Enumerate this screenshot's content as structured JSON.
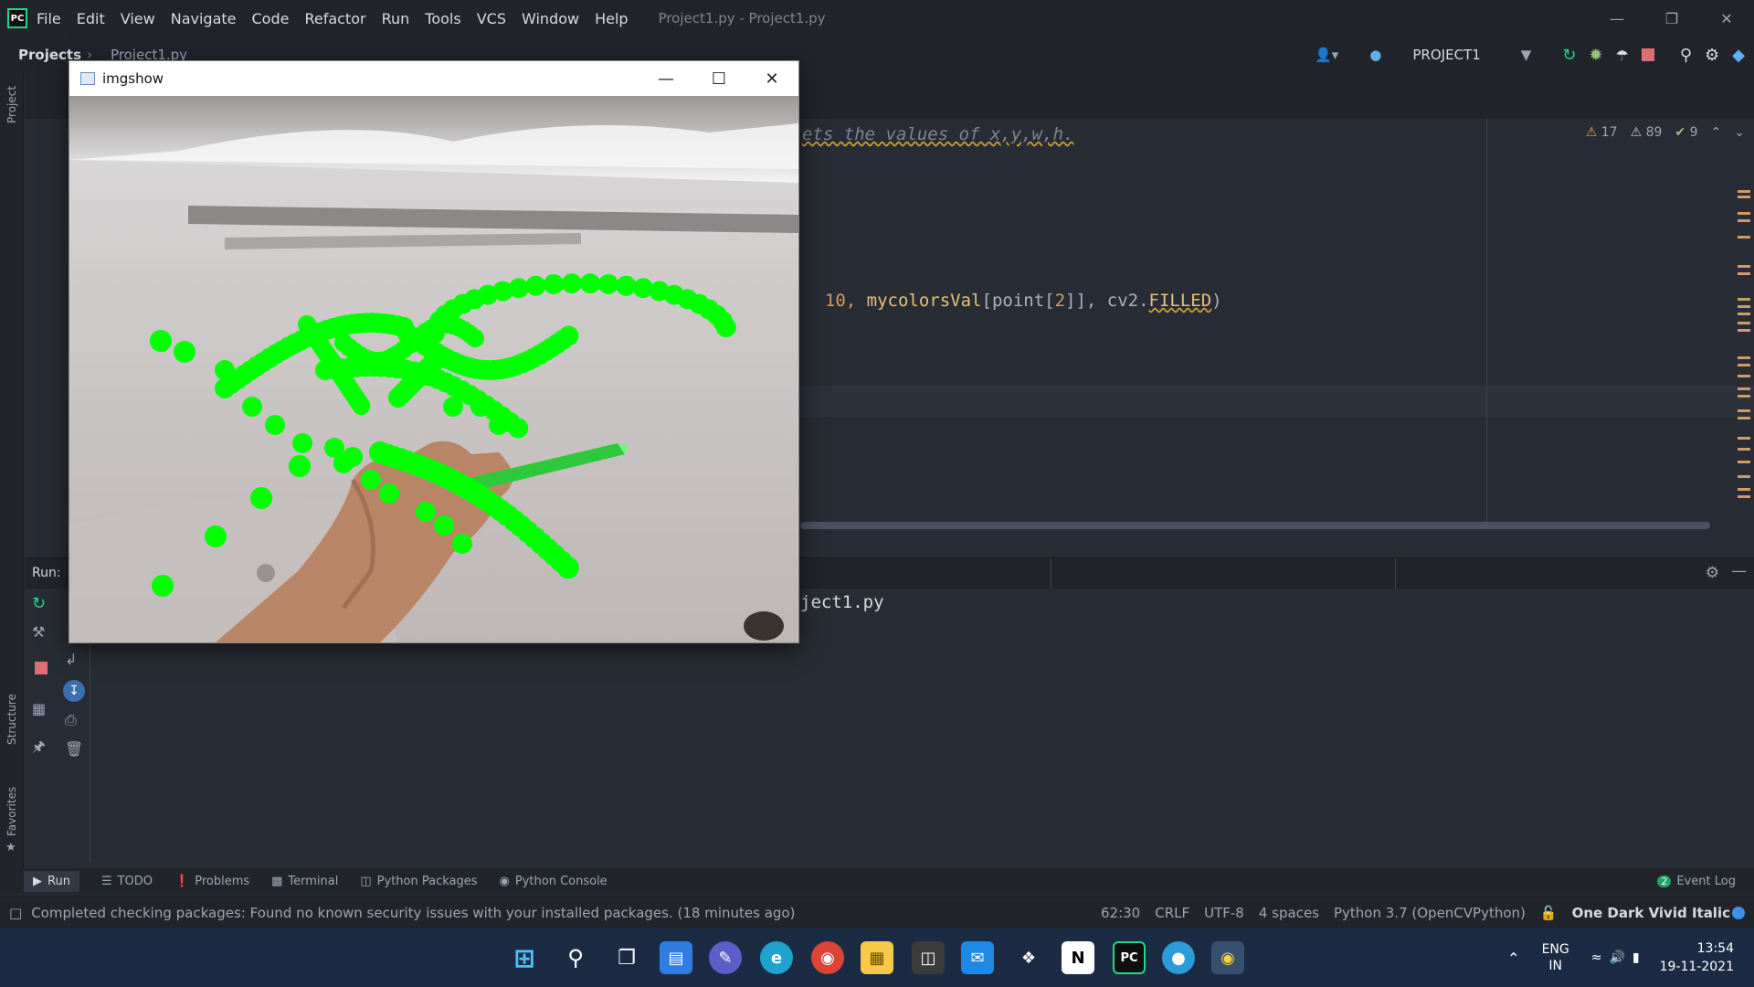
{
  "app": {
    "title": "Project1.py - Project1.py",
    "logo": "PC",
    "menu": [
      "File",
      "Edit",
      "View",
      "Navigate",
      "Code",
      "Refactor",
      "Run",
      "Tools",
      "VCS",
      "Window",
      "Help"
    ]
  },
  "navbar": {
    "breadcrumb_root": "Projects",
    "breadcrumb_file": "Project1.py",
    "run_config": "PROJECT1"
  },
  "editor": {
    "comment_line": "ets the values of x,y,w,h.",
    "code_line": {
      "prefix": "10, ",
      "fn": "mycolorsVal",
      "rest": "[point[",
      "num": "2",
      "rest2": "]], cv2.",
      "const": "FILLED",
      "close": ")"
    },
    "inspections": {
      "warnings": "17",
      "weak_warnings": "89",
      "ok": "9"
    }
  },
  "run_panel": {
    "label": "Run:",
    "output": "ject1.py"
  },
  "bottom_tabs": [
    "Run",
    "TODO",
    "Problems",
    "Terminal",
    "Python Packages",
    "Python Console"
  ],
  "event_log": {
    "count": "2",
    "label": "Event Log"
  },
  "status": {
    "message": "Completed checking packages: Found no known security issues with your installed packages. (18 minutes ago)",
    "position": "62:30",
    "line_sep": "CRLF",
    "encoding": "UTF-8",
    "indent": "4 spaces",
    "interpreter": "Python 3.7 (OpenCVPython)",
    "theme": "One Dark Vivid Italic"
  },
  "side_labels": {
    "project": "Project",
    "structure": "Structure",
    "favorites": "Favorites"
  },
  "imgshow": {
    "title": "imgshow"
  },
  "taskbar": {
    "lang_top": "ENG",
    "lang_bottom": "IN",
    "time": "13:54",
    "date": "19-11-2021"
  },
  "colors": {
    "accent_green": "#00ff00",
    "editor_bg": "#282c34",
    "chrome_bg": "#21252b",
    "taskbar_bg": "#1c2b44"
  }
}
